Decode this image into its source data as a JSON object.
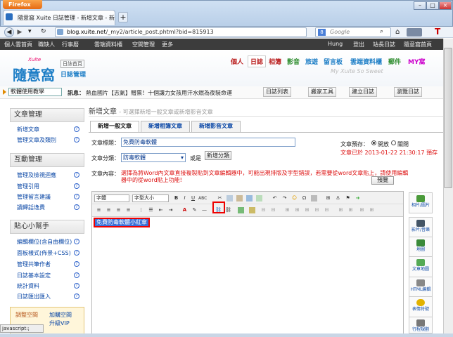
{
  "browser": {
    "menu_label": "Firefox",
    "tab_title": "隨意窩 Xuite 日誌管理 - 新增文章 - 新插...",
    "url_host": "blog.xuite.net",
    "url_rest": "/_my2/article_post.phtml?bid=815913",
    "search_placeholder": "Google"
  },
  "site_top": [
    "個人雲首頁",
    "職缺人",
    "行事曆",
    "雲端資料櫃",
    "空間管理",
    "更多"
  ],
  "site_top_right": [
    "Hung",
    "登出",
    "站長日誌",
    "隨意窩首頁"
  ],
  "logo": {
    "brand": "Xuite",
    "name": "隨意窩",
    "sub": "日誌管理",
    "home": "日誌首頁"
  },
  "site_nav": [
    "個人",
    "日誌",
    "相簿",
    "影音",
    "旅遊",
    "留言板",
    "雲端資料櫃",
    "郵件",
    "MY窩"
  ],
  "watermark": "My Xuite So Sweet",
  "bulletin": {
    "blog_select": "軟體使用教學",
    "msg_label": "訊息：",
    "msg_text": "熱血國片【志氣】贈票！十個讓力女孩用汗水燃為夜裝命運",
    "buttons": [
      "日誌列表",
      "搬家工具",
      "建立日誌",
      "瀏覽日誌"
    ]
  },
  "sidebar": {
    "sections": [
      {
        "title": "文章管理",
        "items": [
          "新增文章",
          "管理文章及類別"
        ]
      },
      {
        "title": "互動管理",
        "items": [
          "管理及檢視迴應",
          "管理引用",
          "管理留言建議",
          "讀歸話逸費"
        ]
      },
      {
        "title": "貼心小幫手",
        "items": [
          "編輯欄位(含自由欄位)",
          "面板樣式(佈景+CSS)",
          "管理共筆作者",
          "日誌基本設定",
          "統計資料",
          "日誌匯出匯入"
        ]
      }
    ],
    "tip": {
      "link1": "調整空間",
      "link2": "加購空間",
      "link3": "升級VIP"
    }
  },
  "main": {
    "title": "新增文章",
    "subtitle": "- 可選擇新增一般文章或新增影音文章",
    "tabs": [
      "新增一般文章",
      "新增相簿文章",
      "新增影音文章"
    ],
    "title_label": "文章標題：",
    "title_value": "免費防毒軟體",
    "category_label": "文章分類：",
    "category_value": "防毒軟體",
    "or_label": "或是",
    "new_category": "新增分類",
    "content_label": "文章內容：",
    "warning": "選擇為將Word內文章直接複製貼到文章編輯器中，可能出現排版及字型錯誤，若需要從word文章貼上，請使用編輯器中的從word貼上功能!",
    "preview": "預覽",
    "publish_label": "文章預存：",
    "publish_open": "開放",
    "publish_closed": "關閉",
    "saved_text": "文章已於 2013-01-22 21:30:17 預存",
    "font_select": "字體",
    "size_select": "字型大小",
    "selected_text": "免費防毒軟體小紅傘"
  },
  "right_tools": [
    "相片/圖片",
    "影片/音樂",
    "地圖",
    "文章地圖",
    "HTML編輯",
    "表情符號",
    "行程規劃"
  ],
  "status_text": "javascript:;"
}
